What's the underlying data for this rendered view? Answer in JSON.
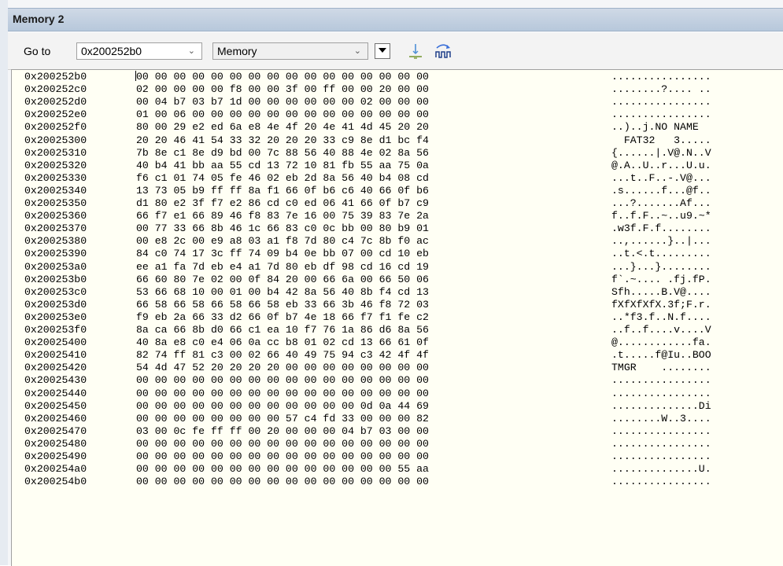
{
  "window": {
    "title": "Memory 2"
  },
  "toolbar": {
    "goto_label": "Go to",
    "address_value": "0x200252b0",
    "memory_type": "Memory",
    "icons": [
      "dropdown-arrow-icon",
      "trace-marker-icon",
      "refresh-bits-icon"
    ]
  },
  "memory": {
    "rows": [
      {
        "addr": "0x200252b0",
        "hex": "00 00 00 00 00 00 00 00 00 00 00 00 00 00 00 00",
        "ascii": "................"
      },
      {
        "addr": "0x200252c0",
        "hex": "02 00 00 00 00 f8 00 00 3f 00 ff 00 00 20 00 00",
        "ascii": "........?.... .."
      },
      {
        "addr": "0x200252d0",
        "hex": "00 04 b7 03 b7 1d 00 00 00 00 00 00 02 00 00 00",
        "ascii": "................"
      },
      {
        "addr": "0x200252e0",
        "hex": "01 00 06 00 00 00 00 00 00 00 00 00 00 00 00 00",
        "ascii": "................"
      },
      {
        "addr": "0x200252f0",
        "hex": "80 00 29 e2 ed 6a e8 4e 4f 20 4e 41 4d 45 20 20",
        "ascii": "..)..j.NO NAME  "
      },
      {
        "addr": "0x20025300",
        "hex": "20 20 46 41 54 33 32 20 20 20 33 c9 8e d1 bc f4",
        "ascii": "  FAT32   3....."
      },
      {
        "addr": "0x20025310",
        "hex": "7b 8e c1 8e d9 bd 00 7c 88 56 40 88 4e 02 8a 56",
        "ascii": "{......|.V@.N..V"
      },
      {
        "addr": "0x20025320",
        "hex": "40 b4 41 bb aa 55 cd 13 72 10 81 fb 55 aa 75 0a",
        "ascii": "@.A..U..r...U.u."
      },
      {
        "addr": "0x20025330",
        "hex": "f6 c1 01 74 05 fe 46 02 eb 2d 8a 56 40 b4 08 cd",
        "ascii": "...t..F..-.V@..."
      },
      {
        "addr": "0x20025340",
        "hex": "13 73 05 b9 ff ff 8a f1 66 0f b6 c6 40 66 0f b6",
        "ascii": ".s......f...@f.."
      },
      {
        "addr": "0x20025350",
        "hex": "d1 80 e2 3f f7 e2 86 cd c0 ed 06 41 66 0f b7 c9",
        "ascii": "...?.......Af..."
      },
      {
        "addr": "0x20025360",
        "hex": "66 f7 e1 66 89 46 f8 83 7e 16 00 75 39 83 7e 2a",
        "ascii": "f..f.F..~..u9.~*"
      },
      {
        "addr": "0x20025370",
        "hex": "00 77 33 66 8b 46 1c 66 83 c0 0c bb 00 80 b9 01",
        "ascii": ".w3f.F.f........"
      },
      {
        "addr": "0x20025380",
        "hex": "00 e8 2c 00 e9 a8 03 a1 f8 7d 80 c4 7c 8b f0 ac",
        "ascii": "..,......}..|..."
      },
      {
        "addr": "0x20025390",
        "hex": "84 c0 74 17 3c ff 74 09 b4 0e bb 07 00 cd 10 eb",
        "ascii": "..t.<.t........."
      },
      {
        "addr": "0x200253a0",
        "hex": "ee a1 fa 7d eb e4 a1 7d 80 eb df 98 cd 16 cd 19",
        "ascii": "...}...}........"
      },
      {
        "addr": "0x200253b0",
        "hex": "66 60 80 7e 02 00 0f 84 20 00 66 6a 00 66 50 06",
        "ascii": "f`.~.... .fj.fP."
      },
      {
        "addr": "0x200253c0",
        "hex": "53 66 68 10 00 01 00 b4 42 8a 56 40 8b f4 cd 13",
        "ascii": "Sfh.....B.V@...."
      },
      {
        "addr": "0x200253d0",
        "hex": "66 58 66 58 66 58 66 58 eb 33 66 3b 46 f8 72 03",
        "ascii": "fXfXfXfX.3f;F.r."
      },
      {
        "addr": "0x200253e0",
        "hex": "f9 eb 2a 66 33 d2 66 0f b7 4e 18 66 f7 f1 fe c2",
        "ascii": "..*f3.f..N.f...."
      },
      {
        "addr": "0x200253f0",
        "hex": "8a ca 66 8b d0 66 c1 ea 10 f7 76 1a 86 d6 8a 56",
        "ascii": "..f..f....v....V"
      },
      {
        "addr": "0x20025400",
        "hex": "40 8a e8 c0 e4 06 0a cc b8 01 02 cd 13 66 61 0f",
        "ascii": "@............fa."
      },
      {
        "addr": "0x20025410",
        "hex": "82 74 ff 81 c3 00 02 66 40 49 75 94 c3 42 4f 4f",
        "ascii": ".t.....f@Iu..BOO"
      },
      {
        "addr": "0x20025420",
        "hex": "54 4d 47 52 20 20 20 20 00 00 00 00 00 00 00 00",
        "ascii": "TMGR    ........"
      },
      {
        "addr": "0x20025430",
        "hex": "00 00 00 00 00 00 00 00 00 00 00 00 00 00 00 00",
        "ascii": "................"
      },
      {
        "addr": "0x20025440",
        "hex": "00 00 00 00 00 00 00 00 00 00 00 00 00 00 00 00",
        "ascii": "................"
      },
      {
        "addr": "0x20025450",
        "hex": "00 00 00 00 00 00 00 00 00 00 00 00 0d 0a 44 69",
        "ascii": "..............Di"
      },
      {
        "addr": "0x20025460",
        "hex": "00 00 00 00 00 00 00 00 57 c4 fd 33 00 00 00 82",
        "ascii": "........W..3...."
      },
      {
        "addr": "0x20025470",
        "hex": "03 00 0c fe ff ff 00 20 00 00 00 04 b7 03 00 00",
        "ascii": "................"
      },
      {
        "addr": "0x20025480",
        "hex": "00 00 00 00 00 00 00 00 00 00 00 00 00 00 00 00",
        "ascii": "................"
      },
      {
        "addr": "0x20025490",
        "hex": "00 00 00 00 00 00 00 00 00 00 00 00 00 00 00 00",
        "ascii": "................"
      },
      {
        "addr": "0x200254a0",
        "hex": "00 00 00 00 00 00 00 00 00 00 00 00 00 00 55 aa",
        "ascii": "..............U."
      },
      {
        "addr": "0x200254b0",
        "hex": "00 00 00 00 00 00 00 00 00 00 00 00 00 00 00 00",
        "ascii": "................"
      }
    ]
  }
}
